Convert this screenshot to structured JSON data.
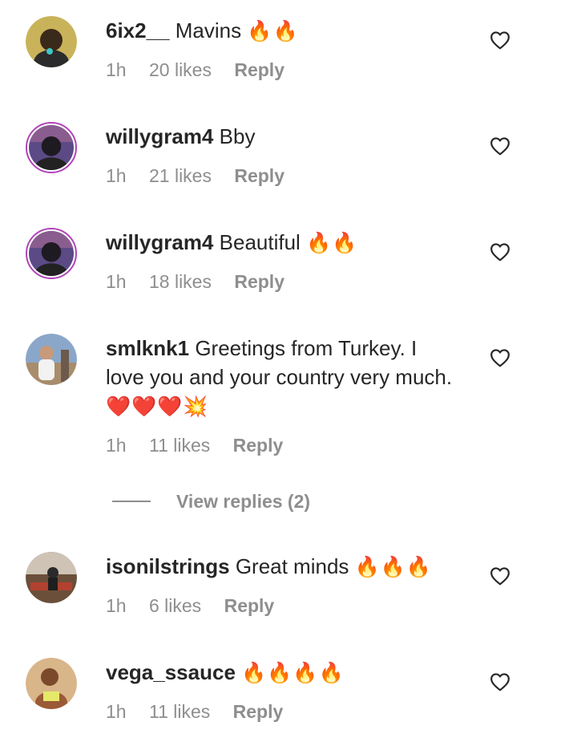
{
  "comments": [
    {
      "username": "6ix2__",
      "text": "Mavins",
      "emoji": "🔥🔥",
      "time": "1h",
      "likes": "20 likes",
      "reply": "Reply",
      "avatar_colors": [
        "#c9b35a",
        "#3a2a1a"
      ]
    },
    {
      "username": "willygram4",
      "text": "Bby",
      "emoji": "",
      "time": "1h",
      "likes": "21 likes",
      "reply": "Reply",
      "avatar_colors": [
        "#5b4a86",
        "#1e1a22"
      ]
    },
    {
      "username": "willygram4",
      "text": "Beautiful",
      "emoji": "🔥🔥",
      "time": "1h",
      "likes": "18 likes",
      "reply": "Reply",
      "avatar_colors": [
        "#5b4a86",
        "#1e1a22"
      ]
    },
    {
      "username": "smlknk1",
      "text": "Greetings from Turkey. I love you and your country very much.",
      "emoji": "❤️❤️❤️💥",
      "time": "1h",
      "likes": "11 likes",
      "reply": "Reply",
      "avatar_colors": [
        "#8aa7c9",
        "#d8d0c6"
      ]
    },
    {
      "username": "isonilstrings",
      "text": "Great minds",
      "emoji": "🔥🔥🔥",
      "time": "1h",
      "likes": "6 likes",
      "reply": "Reply",
      "avatar_colors": [
        "#6b4f3a",
        "#b3412f"
      ]
    },
    {
      "username": "vega_ssauce",
      "text": "",
      "emoji": "🔥🔥🔥🔥",
      "time": "1h",
      "likes": "11 likes",
      "reply": "Reply",
      "avatar_colors": [
        "#d9b58a",
        "#7a4a2a"
      ]
    }
  ],
  "view_replies": "View replies (2)",
  "icons": {
    "like": "heart-outline-icon"
  },
  "colors": {
    "text": "#262626",
    "secondary": "#8e8e8e",
    "story_ring": "#b044b8"
  }
}
